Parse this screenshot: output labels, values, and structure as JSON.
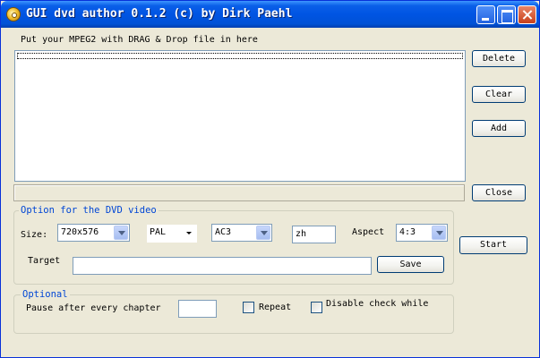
{
  "window": {
    "title": "GUI dvd author 0.1.2 (c) by Dirk Paehl"
  },
  "file_area": {
    "instruction": "Put your MPEG2 with DRAG & Drop file in here",
    "files": []
  },
  "side_buttons": {
    "delete": "Delete",
    "clear": "Clear",
    "add": "Add",
    "close": "Close",
    "start": "Start"
  },
  "dvd_options": {
    "group_title": "Option for the DVD video",
    "size_label": "Size:",
    "size_value": "720x576",
    "standard_value": "PAL",
    "audio_value": "AC3",
    "language_value": "zh",
    "aspect_label": "Aspect",
    "aspect_value": "4:3",
    "target_label": "Target",
    "target_value": "",
    "save_label": "Save"
  },
  "optional": {
    "group_title": "Optional",
    "pause_label": "Pause after every chapter",
    "pause_value": "",
    "repeat_label": "Repeat",
    "repeat_checked": false,
    "disable_check_label": "Disable check while",
    "disable_check_checked": false
  },
  "colors": {
    "titlebar": "#0054e3",
    "window_bg": "#ece9d8",
    "group_title": "#0046d5"
  }
}
